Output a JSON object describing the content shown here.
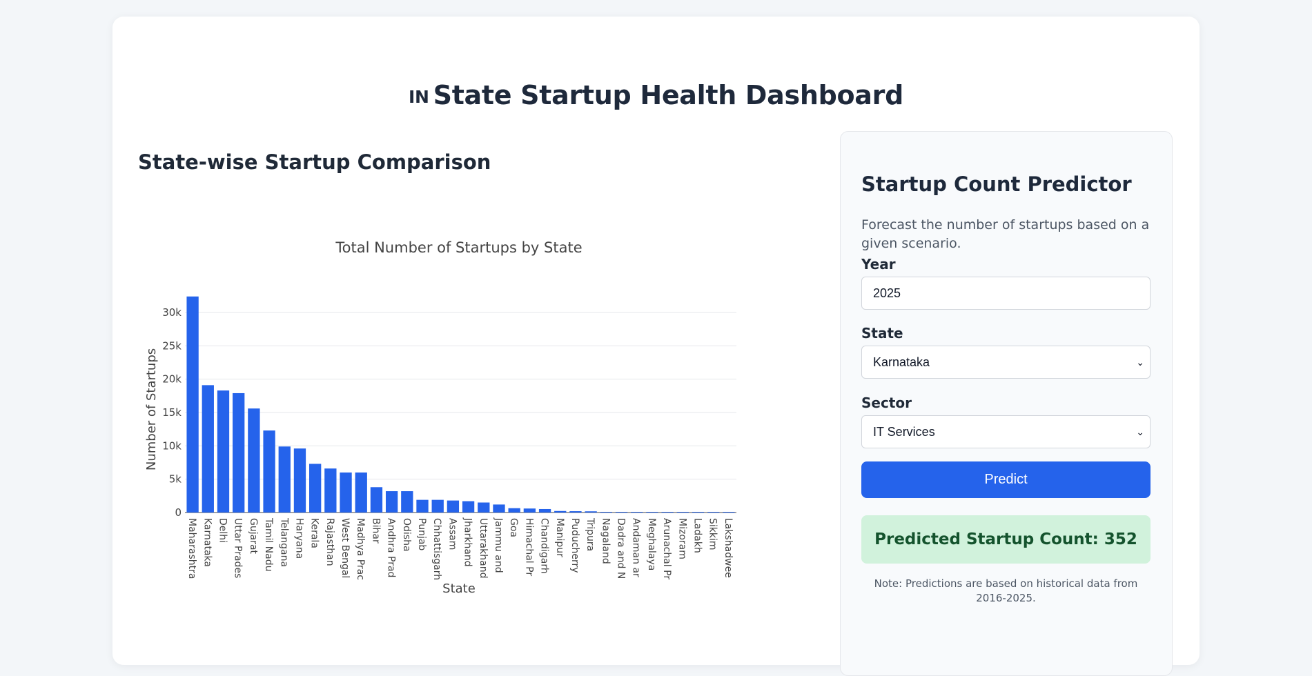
{
  "header": {
    "flag_text": "IN",
    "title": "State Startup Health Dashboard"
  },
  "comparison": {
    "section_title": "State-wise Startup Comparison"
  },
  "predictor": {
    "title": "Startup Count Predictor",
    "description": "Forecast the number of startups based on a given scenario.",
    "year_label": "Year",
    "year_value": "2025",
    "state_label": "State",
    "state_value": "Karnataka",
    "sector_label": "Sector",
    "sector_value": "IT Services",
    "predict_button": "Predict",
    "result_text": "Predicted Startup Count: 352",
    "note": "Note: Predictions are based on historical data from 2016-2025."
  },
  "colors": {
    "bar": "#2563eb",
    "button": "#2563eb",
    "result_bg": "#d1f2dc",
    "result_text": "#14532d"
  },
  "icons": {
    "select_chevron": "chevron-down-icon"
  },
  "chart_data": {
    "type": "bar",
    "title": "Total Number of Startups by State",
    "xlabel": "State",
    "ylabel": "Number of Startups",
    "ylim": [
      0,
      33000
    ],
    "grid": true,
    "yticks": [
      0,
      5000,
      10000,
      15000,
      20000,
      25000,
      30000
    ],
    "ytick_labels": [
      "0",
      "5k",
      "10k",
      "15k",
      "20k",
      "25k",
      "30k"
    ],
    "categories": [
      "Maharashtra",
      "Karnataka",
      "Delhi",
      "Uttar Pradesh",
      "Gujarat",
      "Tamil Nadu",
      "Telangana",
      "Haryana",
      "Kerala",
      "Rajasthan",
      "West Bengal",
      "Madhya Pradesh",
      "Bihar",
      "Andhra Pradesh",
      "Odisha",
      "Punjab",
      "Chhattisgarh",
      "Assam",
      "Jharkhand",
      "Uttarakhand",
      "Jammu and Kashmir",
      "Goa",
      "Himachal Pradesh",
      "Chandigarh",
      "Manipur",
      "Puducherry",
      "Tripura",
      "Nagaland",
      "Dadra and Nagar Haveli and Daman and Diu",
      "Andaman and Nicobar Islands",
      "Meghalaya",
      "Arunachal Pradesh",
      "Mizoram",
      "Ladakh",
      "Sikkim",
      "Lakshadweep"
    ],
    "tick_labels": [
      "Maharashtra",
      "Karnataka",
      "Delhi",
      "Uttar Prades",
      "Gujarat",
      "Tamil Nadu",
      "Telangana",
      "Haryana",
      "Kerala",
      "Rajasthan",
      "West Bengal",
      "Madhya Prac",
      "Bihar",
      "Andhra Prad",
      "Odisha",
      "Punjab",
      "Chhattisgarh",
      "Assam",
      "Jharkhand",
      "Uttarakhand",
      "Jammu and",
      "Goa",
      "Himachal Pr",
      "Chandigarh",
      "Manipur",
      "Puducherry",
      "Tripura",
      "Nagaland",
      "Dadra and N",
      "Andaman ar",
      "Meghalaya",
      "Arunachal Pr",
      "Mizoram",
      "Ladakh",
      "Sikkim",
      "Lakshadwee"
    ],
    "values": [
      32400,
      19100,
      18300,
      17900,
      15600,
      12300,
      9900,
      9600,
      7300,
      6600,
      6000,
      6000,
      3800,
      3200,
      3200,
      1900,
      1900,
      1800,
      1700,
      1500,
      1200,
      650,
      600,
      520,
      230,
      200,
      180,
      100,
      90,
      80,
      80,
      70,
      60,
      40,
      40,
      20
    ]
  }
}
